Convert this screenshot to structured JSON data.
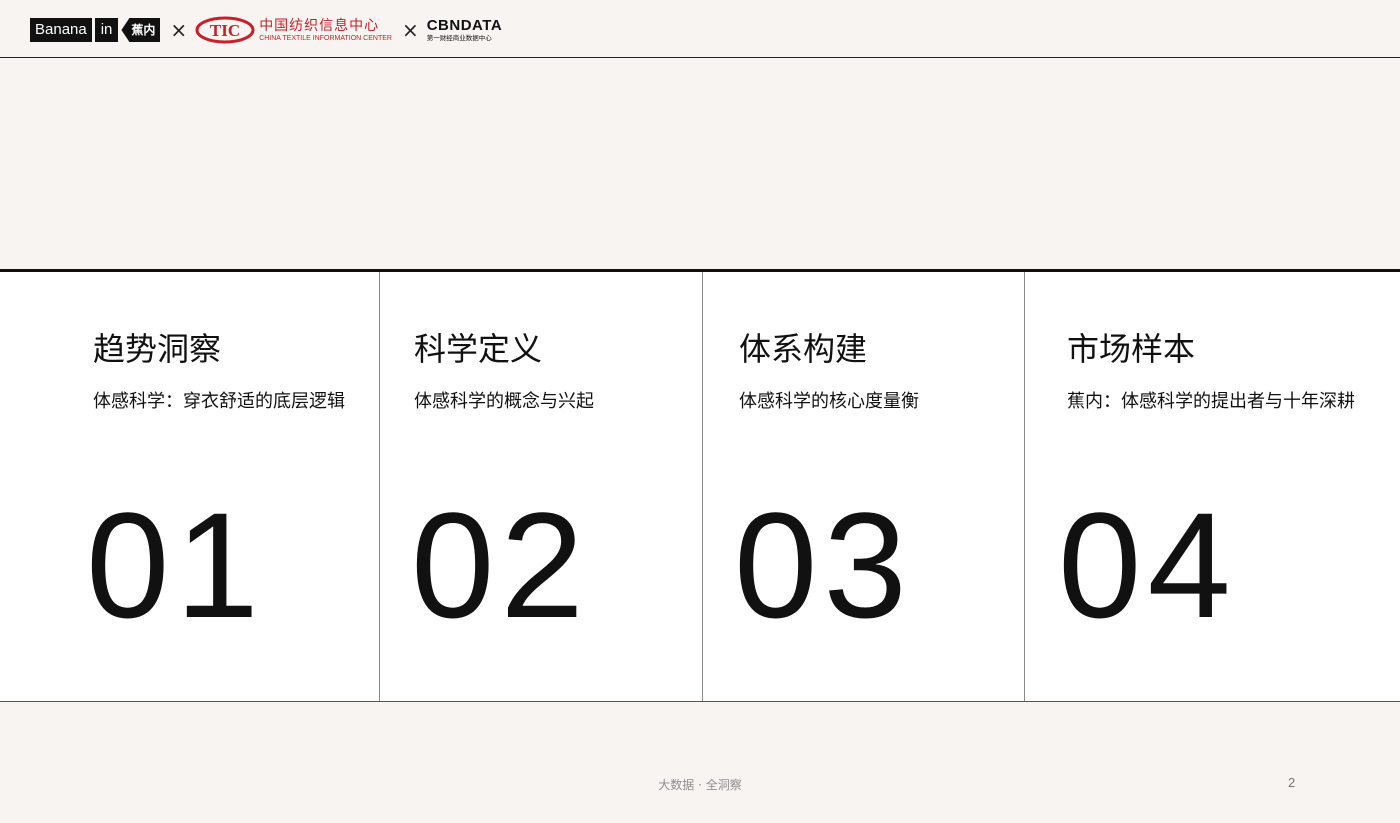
{
  "header": {
    "logos": {
      "bananain": {
        "name": "Banana",
        "in": "in",
        "cn": "蕉内"
      },
      "separator": "×",
      "ctic": {
        "mark": "TIC",
        "cn": "中国纺织信息中心",
        "en": "CHINA TEXTILE INFORMATION CENTER"
      },
      "cbndata": {
        "name": "CBNDATA",
        "sub": "第一财经商业数据中心"
      }
    }
  },
  "sections": [
    {
      "title": "趋势洞察",
      "subtitle": "体感科学：穿衣舒适的底层逻辑",
      "number": "01"
    },
    {
      "title": "科学定义",
      "subtitle": "体感科学的概念与兴起",
      "number": "02"
    },
    {
      "title": "体系构建",
      "subtitle": "体感科学的核心度量衡",
      "number": "03"
    },
    {
      "title": "市场样本",
      "subtitle": "蕉内：体感科学的提出者与十年深耕",
      "number": "04"
    }
  ],
  "footer": {
    "tagline": "大数据 · 全洞察",
    "page_number": "2"
  },
  "colors": {
    "background": "#f7f4f1",
    "ctic_red": "#c8202a",
    "text": "#111111"
  }
}
